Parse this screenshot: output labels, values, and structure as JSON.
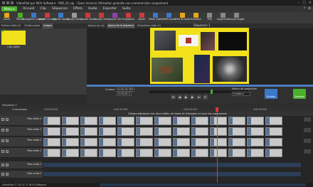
{
  "window": {
    "title": "VideoPad par NCH Software - MID_02.vpj - [Sans licence] Utilisation gratuite non-commerciale uniquement"
  },
  "menubar": {
    "menu_label": "Menu ▾",
    "items": [
      "Accueil",
      "Clip",
      "Séquence",
      "Effets",
      "Audio",
      "Exporter",
      "Suite"
    ]
  },
  "toolbar": {
    "items": [
      {
        "label": "Ouvrir",
        "color": "#e6a817"
      },
      {
        "label": "Médias",
        "color": "#4caf2e"
      },
      {
        "label": "Enregistrer le projet",
        "color": "#3b79c9"
      },
      {
        "label": "Ajouter un texte",
        "color": "#cc3b3b"
      },
      {
        "label": "Ajouter objets",
        "color": "#3b79c9"
      },
      {
        "label": "Ajouter blanc",
        "color": "#999999"
      },
      {
        "label": "Ajouter texte",
        "color": "#cc3b3b"
      },
      {
        "label": "Ajouter titre",
        "color": "#cc3b3b"
      },
      {
        "label": "Ajouter film",
        "color": "#8e44ad"
      },
      {
        "label": "Enregistrer",
        "color": "#cc3b3b"
      },
      {
        "label": "Narrer",
        "color": "#cc3b3b"
      },
      {
        "label": "Effets vidéo",
        "color": "#3b79c9"
      },
      {
        "label": "Effets audio",
        "color": "#3b79c9"
      },
      {
        "label": "Effet de texte",
        "color": "#e6a817"
      },
      {
        "label": "Transition",
        "color": "#e6a817"
      },
      {
        "label": "Trim",
        "color": "#888888"
      },
      {
        "label": "Supprimer",
        "color": "#888888"
      },
      {
        "label": "Nouvel onglet",
        "color": "#888888"
      }
    ]
  },
  "media": {
    "tabs": [
      "Fichiers vidéo (1)",
      "Fichiers audio",
      "Images"
    ],
    "active_tab": 2,
    "clip_label": "Clip vidéo"
  },
  "preview": {
    "tabs": [
      "Aperçu du clip",
      "Aperçu de la séquence",
      "Échantillon vidéo (1)"
    ],
    "sequence_title": "Séquence 1",
    "cursor_label": "Curseur",
    "cursor_time": "0:00:16.393",
    "duration_time": "0:00:44.2",
    "projection_label": "Valeur de projection",
    "projection_value": "Contenu",
    "split_label": "Scinder",
    "export_label": "Exporter"
  },
  "timeline": {
    "tab_label": "Séquence 1",
    "ruler_label": "Chronologie",
    "ticks": [
      "0:00:00.000",
      "0:00:10.000",
      "0:00:20.000",
      "0:00:30.000"
    ],
    "hint": "Glissez-déplacez vos clips vidéo, de texte et d'images ici pour les superposer",
    "tracks": [
      {
        "name": "Piste vidéo 4"
      },
      {
        "name": "Piste vidéo 3"
      },
      {
        "name": "Piste vidéo 2"
      },
      {
        "name": "Piste vidéo 1"
      },
      {
        "name": "Piste audio 1"
      },
      {
        "name": "Piste audio 2"
      }
    ]
  },
  "status": {
    "text": "VideoPad © 10.32 © NCH Software"
  }
}
